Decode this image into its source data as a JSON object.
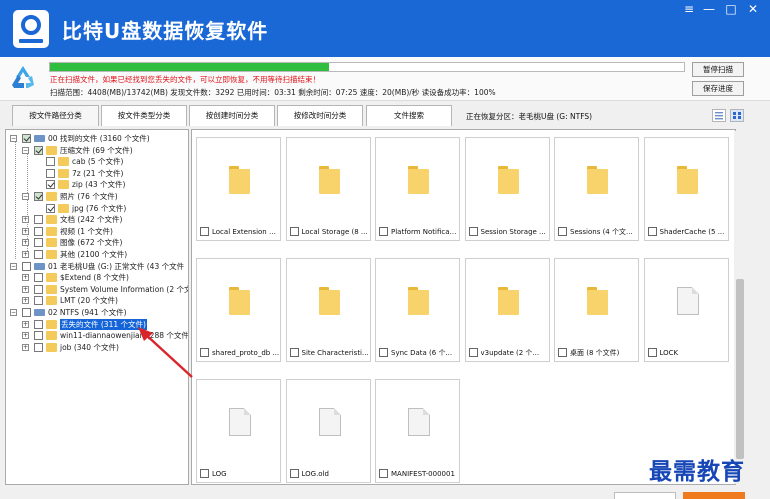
{
  "app": {
    "title": "比特U盘数据恢复软件"
  },
  "window_controls": {
    "menu": "≡",
    "minimize": "—",
    "maximize": "□",
    "close": "✕"
  },
  "scan": {
    "progress": 0.44,
    "warning": "正在扫描文件，如果已经找到您丢失的文件，可以立即恢复，不用等待扫描结束！",
    "stats": "扫描范围：4408(MB)/13742(MB)    发现文件数：3292    已用时间：03:31    剩余时间：07:25    速度：20(MB)/秒    读设备成功率：100%",
    "pause_button": "暂停扫描",
    "save_button": "保存进度"
  },
  "tabs": [
    {
      "label": "按文件路径分类",
      "active": true
    },
    {
      "label": "按文件类型分类"
    },
    {
      "label": "按创建时间分类"
    },
    {
      "label": "按修改时间分类"
    },
    {
      "label": "文件搜索"
    }
  ],
  "location": "正在恢复分区：老毛桃U盘 (G: NTFS)",
  "tree": [
    {
      "label": "00 找到的文件   (3160 个文件)",
      "level": 0,
      "exp": "−",
      "check": "partial",
      "icon": "drive"
    },
    {
      "label": "压缩文件   (69 个文件)",
      "level": 1,
      "exp": "−",
      "check": "partial",
      "icon": "folder"
    },
    {
      "label": "cab     (5 个文件)",
      "level": 2,
      "exp": "",
      "check": "none",
      "icon": "folder"
    },
    {
      "label": "7z      (21 个文件)",
      "level": 2,
      "exp": "",
      "check": "none",
      "icon": "folder"
    },
    {
      "label": "zip     (43 个文件)",
      "level": 2,
      "exp": "",
      "check": "checked",
      "icon": "folder"
    },
    {
      "label": "照片   (76 个文件)",
      "level": 1,
      "exp": "−",
      "check": "partial",
      "icon": "folder"
    },
    {
      "label": "jpg     (76 个文件)",
      "level": 2,
      "exp": "",
      "check": "checked",
      "icon": "folder"
    },
    {
      "label": "文档   (242 个文件)",
      "level": 1,
      "exp": "+",
      "check": "none",
      "icon": "folder"
    },
    {
      "label": "视频   (1 个文件)",
      "level": 1,
      "exp": "+",
      "check": "none",
      "icon": "folder"
    },
    {
      "label": "图像   (672 个文件)",
      "level": 1,
      "exp": "+",
      "check": "none",
      "icon": "folder"
    },
    {
      "label": "其他   (2100 个文件)",
      "level": 1,
      "exp": "+",
      "check": "none",
      "icon": "folder"
    },
    {
      "label": "01 老毛桃U盘 (G:) 正常文件  (43 个文件",
      "level": 0,
      "exp": "−",
      "check": "none",
      "icon": "drive"
    },
    {
      "label": "$Extend    (8 个文件)",
      "level": 1,
      "exp": "+",
      "check": "none",
      "icon": "folder"
    },
    {
      "label": "System Volume Information     (2 个文",
      "level": 1,
      "exp": "+",
      "check": "none",
      "icon": "folder"
    },
    {
      "label": "LMT    (20 个文件)",
      "level": 1,
      "exp": "+",
      "check": "none",
      "icon": "folder"
    },
    {
      "label": "02  NTFS   (941 个文件)",
      "level": 0,
      "exp": "−",
      "check": "none",
      "icon": "drive"
    },
    {
      "label": "丢失的文件     (311 个文件)",
      "level": 1,
      "exp": "+",
      "check": "none",
      "icon": "folder",
      "selected": true
    },
    {
      "label": "win11-diannaowenjian       (288 个文件",
      "level": 1,
      "exp": "+",
      "check": "none",
      "icon": "folder"
    },
    {
      "label": "job    (340 个文件)",
      "level": 1,
      "exp": "+",
      "check": "none",
      "icon": "folder"
    }
  ],
  "files": [
    {
      "name": "Local Extension S...",
      "kind": "folder"
    },
    {
      "name": "Local Storage  (8 ...",
      "kind": "folder"
    },
    {
      "name": "Platform Notificati...",
      "kind": "folder"
    },
    {
      "name": "Session Storage  ...",
      "kind": "folder"
    },
    {
      "name": "Sessions  (4 个文...",
      "kind": "folder"
    },
    {
      "name": "ShaderCache  (5 ...",
      "kind": "folder"
    },
    {
      "name": "shared_proto_db ...",
      "kind": "folder"
    },
    {
      "name": "Site Characteristi...",
      "kind": "folder"
    },
    {
      "name": "Sync Data  (6 个...",
      "kind": "folder"
    },
    {
      "name": "v3update  (2 个...",
      "kind": "folder"
    },
    {
      "name": "桌面  (8 个文件)",
      "kind": "folder"
    },
    {
      "name": "LOCK",
      "kind": "file"
    },
    {
      "name": "LOG",
      "kind": "file"
    },
    {
      "name": "LOG.old",
      "kind": "file"
    },
    {
      "name": "MANIFEST-000001",
      "kind": "file"
    }
  ],
  "watermark": "最需教育",
  "colors": {
    "titlebar": "#1a67d6",
    "progress": "#2fbe3f",
    "warning": "#e2121b",
    "selection": "#1565d8",
    "arrow": "#d9262c",
    "folder": "#f8d26b"
  }
}
